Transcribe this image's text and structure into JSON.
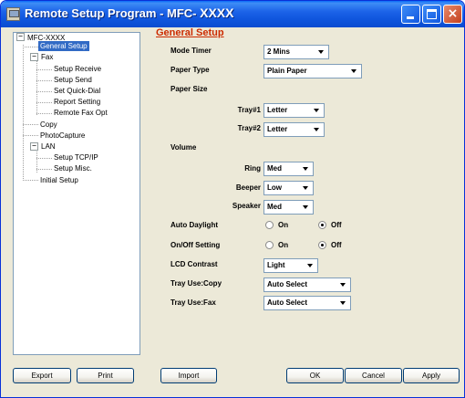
{
  "window": {
    "title_prefix": "Remote Setup Program - MFC- ",
    "title_model": "XXXX"
  },
  "tree": {
    "items": [
      {
        "label": "MFC-XXXX"
      },
      {
        "label": "General Setup"
      },
      {
        "label": "Fax"
      },
      {
        "label": "Setup Receive"
      },
      {
        "label": "Setup Send"
      },
      {
        "label": "Set Quick-Dial"
      },
      {
        "label": "Report Setting"
      },
      {
        "label": "Remote Fax Opt"
      },
      {
        "label": "Copy"
      },
      {
        "label": "PhotoCapture"
      },
      {
        "label": "LAN"
      },
      {
        "label": "Setup TCP/IP"
      },
      {
        "label": "Setup Misc."
      },
      {
        "label": "Initial Setup"
      }
    ],
    "expander_symbol": "−"
  },
  "main": {
    "section_title": "General Setup",
    "mode_timer": {
      "label": "Mode Timer",
      "value": "2 Mins"
    },
    "paper_type": {
      "label": "Paper Type",
      "value": "Plain Paper"
    },
    "paper_size": {
      "label": "Paper Size",
      "tray1": {
        "label": "Tray#1",
        "value": "Letter"
      },
      "tray2": {
        "label": "Tray#2",
        "value": "Letter"
      }
    },
    "volume": {
      "label": "Volume",
      "ring": {
        "label": "Ring",
        "value": "Med"
      },
      "beeper": {
        "label": "Beeper",
        "value": "Low"
      },
      "speaker": {
        "label": "Speaker",
        "value": "Med"
      }
    },
    "auto_daylight": {
      "label": "Auto Daylight",
      "on_label": "On",
      "off_label": "Off",
      "selected": "Off"
    },
    "onoff_setting": {
      "label": "On/Off Setting",
      "on_label": "On",
      "off_label": "Off",
      "selected": "Off"
    },
    "lcd_contrast": {
      "label": "LCD Contrast",
      "value": "Light"
    },
    "tray_use_copy": {
      "label": "Tray Use:Copy",
      "value": "Auto Select"
    },
    "tray_use_fax": {
      "label": "Tray Use:Fax",
      "value": "Auto Select"
    }
  },
  "buttons": {
    "export": "Export",
    "print": "Print",
    "import": "Import",
    "ok": "OK",
    "cancel": "Cancel",
    "apply": "Apply"
  },
  "colors": {
    "titlebar": "#0A4CD0",
    "section_title": "#CC2B00",
    "selection": "#316AC5",
    "window_bg": "#ECE9D8"
  }
}
